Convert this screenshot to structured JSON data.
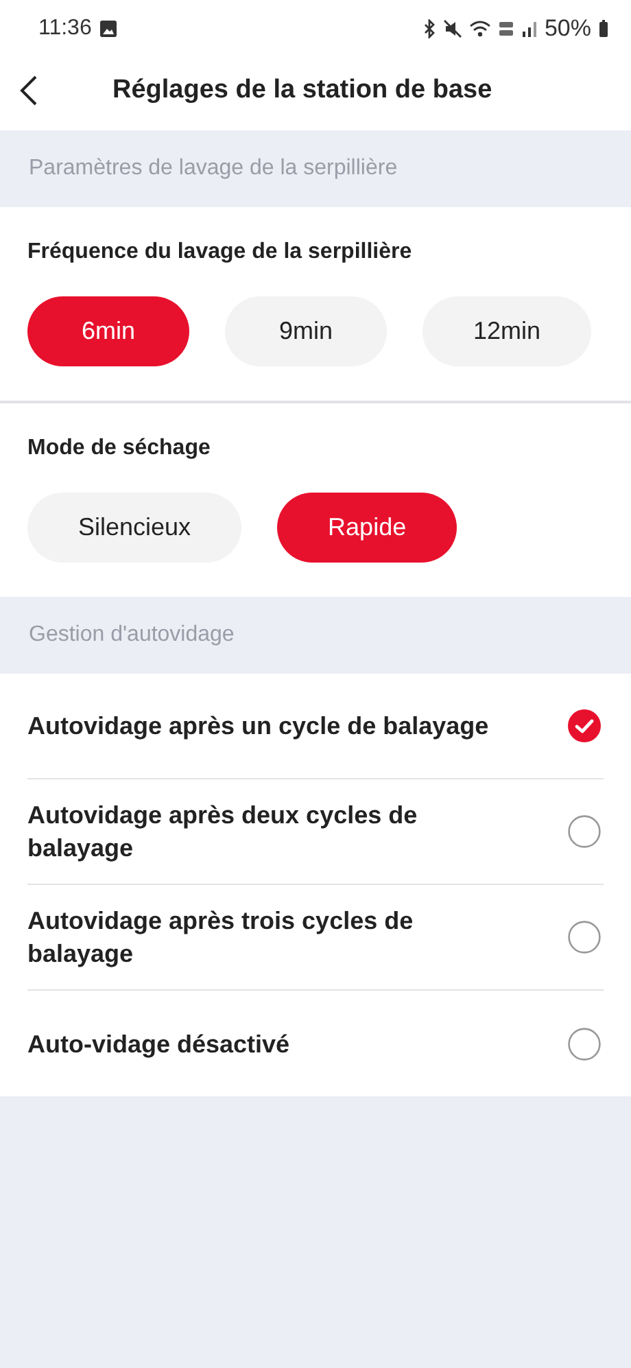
{
  "status_bar": {
    "time": "11:36",
    "battery": "50%"
  },
  "header": {
    "title": "Réglages de la station de base"
  },
  "sections": [
    {
      "title": "Paramètres de lavage de la serpillière",
      "kind": "pills",
      "groups": [
        {
          "label": "Fréquence du lavage de la serpillière",
          "options": [
            {
              "label": "6min",
              "selected": true
            },
            {
              "label": "9min",
              "selected": false
            },
            {
              "label": "12min",
              "selected": false
            }
          ]
        },
        {
          "label": "Mode de séchage",
          "options": [
            {
              "label": "Silencieux",
              "selected": false
            },
            {
              "label": "Rapide",
              "selected": true
            }
          ]
        }
      ]
    },
    {
      "title": "Gestion d'autovidage",
      "kind": "radios",
      "items": [
        {
          "label": "Autovidage après un cycle de balayage",
          "selected": true
        },
        {
          "label": "Autovidage après deux cycles de balayage",
          "selected": false
        },
        {
          "label": "Autovidage après trois cycles de balayage",
          "selected": false
        },
        {
          "label": "Auto-vidage désactivé",
          "selected": false
        }
      ]
    }
  ]
}
